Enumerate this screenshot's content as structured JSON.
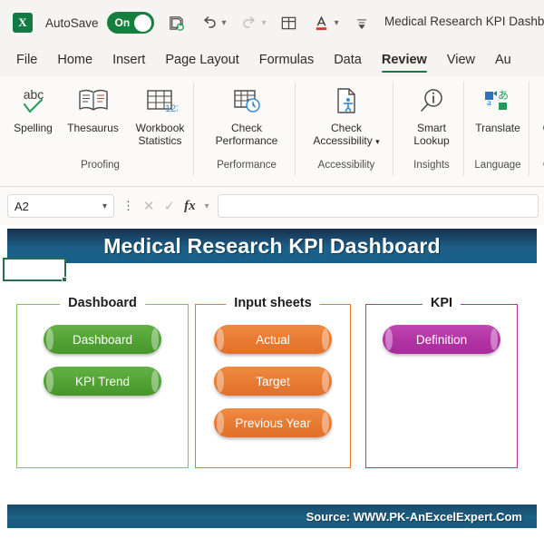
{
  "titlebar": {
    "app_logo": "excel-logo",
    "logo_letter": "X",
    "autosave_label": "AutoSave",
    "autosave_state": "On",
    "save_icon": "save-icon",
    "undo_icon": "undo-icon",
    "redo_icon": "redo-icon",
    "table_icon": "table-icon",
    "font-color_icon": "font-color-icon",
    "customize_icon": "customize-quick-access-icon",
    "document_title": "Medical Research KPI Dashb..."
  },
  "tabs": [
    {
      "label": "File",
      "active": false
    },
    {
      "label": "Home",
      "active": false
    },
    {
      "label": "Insert",
      "active": false
    },
    {
      "label": "Page Layout",
      "active": false
    },
    {
      "label": "Formulas",
      "active": false
    },
    {
      "label": "Data",
      "active": false
    },
    {
      "label": "Review",
      "active": true
    },
    {
      "label": "View",
      "active": false
    },
    {
      "label": "Au",
      "active": false
    }
  ],
  "ribbon": {
    "groups": [
      {
        "name": "Proofing",
        "items": [
          {
            "label": "Spelling",
            "icon": "spelling-abc-check-icon",
            "dropdown": false
          },
          {
            "label": "Thesaurus",
            "icon": "thesaurus-book-icon",
            "dropdown": false
          },
          {
            "label": "Workbook Statistics",
            "icon": "workbook-statistics-icon",
            "dropdown": false
          }
        ]
      },
      {
        "name": "Performance",
        "items": [
          {
            "label": "Check Performance",
            "icon": "check-performance-icon",
            "dropdown": false
          }
        ]
      },
      {
        "name": "Accessibility",
        "items": [
          {
            "label": "Check Accessibility",
            "icon": "check-accessibility-icon",
            "dropdown": true
          }
        ]
      },
      {
        "name": "Insights",
        "items": [
          {
            "label": "Smart Lookup",
            "icon": "smart-lookup-icon",
            "dropdown": false
          }
        ]
      },
      {
        "name": "Language",
        "items": [
          {
            "label": "Translate",
            "icon": "translate-icon",
            "dropdown": false
          }
        ]
      },
      {
        "name": "C",
        "items": [
          {
            "label": "C",
            "icon": "comments-icon",
            "dropdown": false
          }
        ]
      }
    ]
  },
  "formula_bar": {
    "name_box_value": "A2",
    "name_box_chevron": "chevron-down-icon",
    "more_icon": "more-options-icon",
    "cancel_icon": "cancel-x-icon",
    "enter_icon": "enter-check-icon",
    "function_icon": "fx",
    "function_chevron": "chevron-down-icon",
    "formula_value": ""
  },
  "sheet": {
    "banner_title": "Medical Research KPI Dashboard",
    "selected_cell": "A2",
    "footer_text": "Source: WWW.PK-AnExcelExpert.Com",
    "panels": [
      {
        "title": "Dashboard",
        "color": "#8cc152",
        "buttons": [
          {
            "label": "Dashboard"
          },
          {
            "label": "KPI Trend"
          }
        ]
      },
      {
        "title": "Input sheets",
        "color": "#e8762a",
        "buttons": [
          {
            "label": "Actual"
          },
          {
            "label": "Target"
          },
          {
            "label": "Previous Year"
          }
        ]
      },
      {
        "title": "KPI",
        "color": "#b0399f",
        "buttons": [
          {
            "label": "Definition"
          }
        ]
      }
    ]
  }
}
